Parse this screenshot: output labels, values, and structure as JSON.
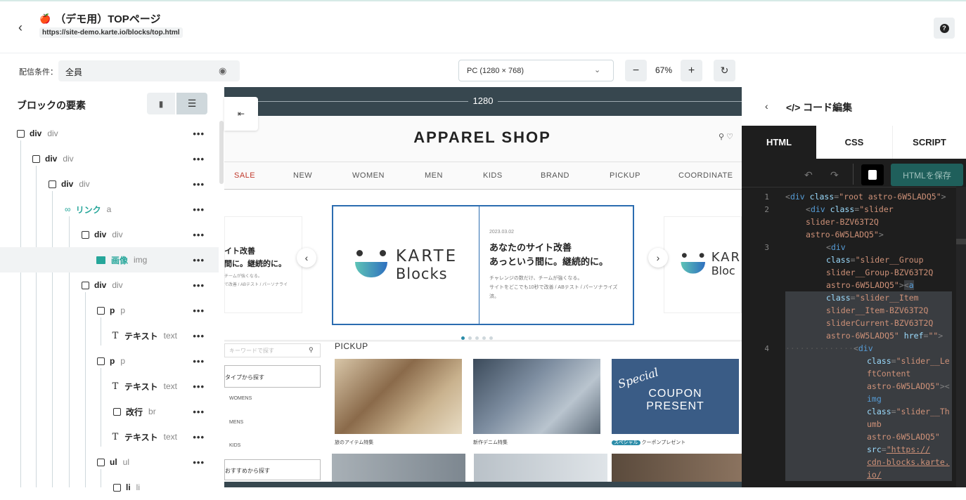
{
  "header": {
    "title": "（デモ用）TOPページ",
    "url": "https://site-demo.karte.io/blocks/top.html"
  },
  "toolbar": {
    "condition_label": "配信条件：",
    "condition_value": "全員",
    "device": "PC (1280 × 768)",
    "zoom": "67%",
    "zoom_out": "−",
    "zoom_in": "+"
  },
  "tree": {
    "title": "ブロックの要素",
    "rows": [
      {
        "name": "div",
        "tag": "div"
      },
      {
        "name": "div",
        "tag": "div"
      },
      {
        "name": "div",
        "tag": "div"
      },
      {
        "name": "リンク",
        "tag": "a"
      },
      {
        "name": "div",
        "tag": "div"
      },
      {
        "name": "画像",
        "tag": "img"
      },
      {
        "name": "div",
        "tag": "div"
      },
      {
        "name": "p",
        "tag": "p"
      },
      {
        "name": "テキスト",
        "tag": "text"
      },
      {
        "name": "p",
        "tag": "p"
      },
      {
        "name": "テキスト",
        "tag": "text"
      },
      {
        "name": "改行",
        "tag": "br"
      },
      {
        "name": "テキスト",
        "tag": "text"
      },
      {
        "name": "ul",
        "tag": "ul"
      },
      {
        "name": "li",
        "tag": "li"
      }
    ],
    "more": "•••"
  },
  "preview": {
    "ruler": "1280",
    "shop_title": "APPAREL SHOP",
    "nav": [
      "SALE",
      "NEW",
      "WOMEN",
      "MEN",
      "KIDS",
      "BRAND",
      "PICKUP",
      "COORDINATE"
    ],
    "slide": {
      "logo_top": "KARTE",
      "logo_bottom": "Blocks",
      "date": "2023.03.02",
      "heading_1": "あなたのサイト改善",
      "heading_2": "あっという間に。継続的に。",
      "body_1": "チャレンジの数だけ、チームが強くなる。",
      "body_2": "サイトをどこでも10秒で改善 / ABテスト / パーソナライズ",
      "body_3": "済。"
    },
    "prev_slide": {
      "heading_1": "イト改善",
      "heading_2": "間に。継続的に。",
      "body_1": "チームが強くなる。",
      "body_2": "で改善 / ABテスト / パーソナライ"
    },
    "next_slide": {
      "logo_top": "KAR",
      "logo_bottom": "Bloc"
    },
    "sidebar": {
      "search_placeholder": "キーワードで探す",
      "type_label": "タイプから探す",
      "items": [
        "WOMENS",
        "MENS",
        "KIDS"
      ],
      "reco_label": "おすすめから探す"
    },
    "pickup_label": "PICKUP",
    "captions": [
      "旅のアイテム特集",
      "新作デニム特集",
      "クーポンプレゼント"
    ],
    "coupon_badge": "スペシャル",
    "coupon_special": "Special",
    "coupon_line1": "COUPON",
    "coupon_line2": "PRESENT"
  },
  "code_editor": {
    "title": "コード編集",
    "tabs": [
      "HTML",
      "CSS",
      "SCRIPT"
    ],
    "save_label": "HTMLを保存",
    "line_numbers": [
      "1",
      "2",
      "3",
      "4"
    ]
  }
}
